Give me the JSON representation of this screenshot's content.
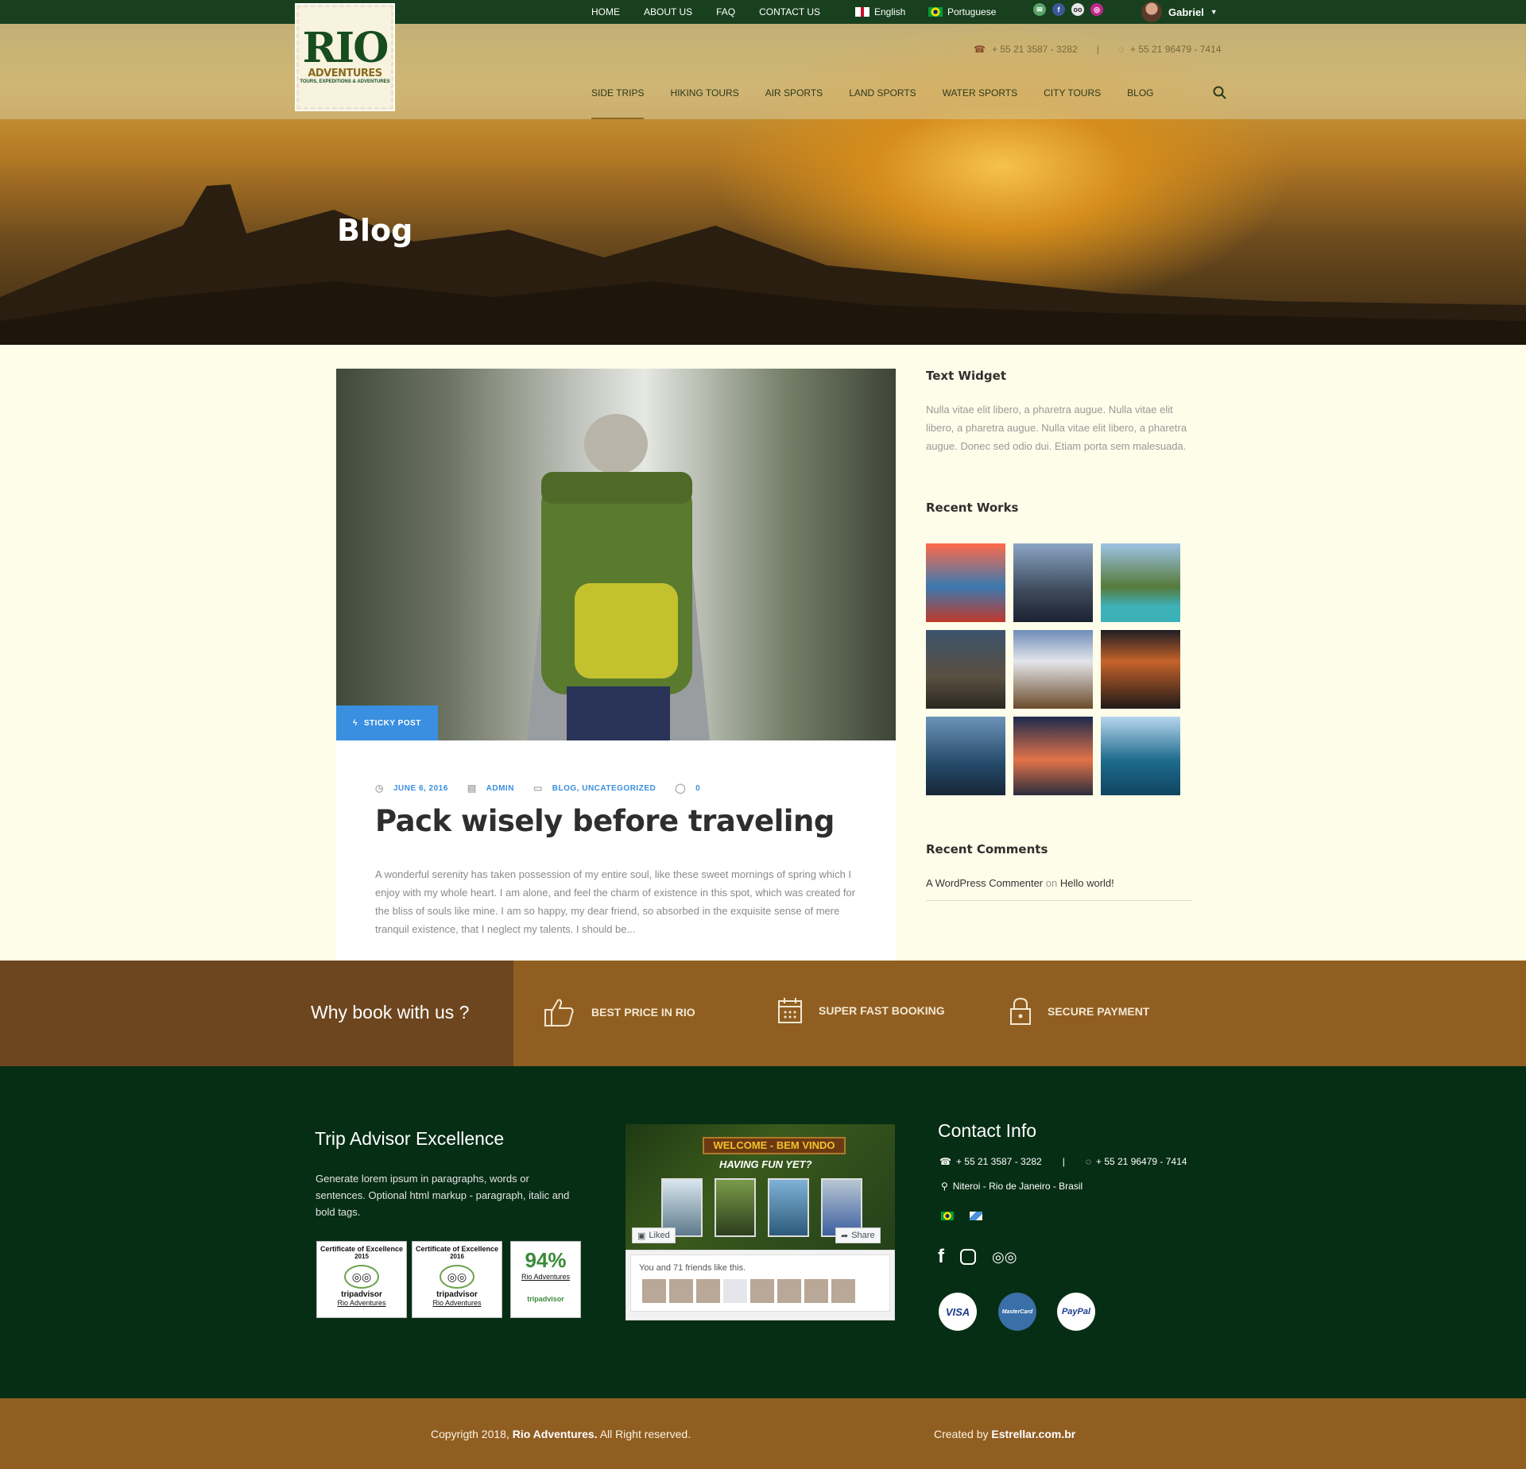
{
  "topbar": {
    "nav": [
      "HOME",
      "ABOUT US",
      "FAQ",
      "CONTACT US"
    ],
    "lang_en": "English",
    "lang_pt": "Portuguese",
    "user_name": "Gabriel"
  },
  "logo": {
    "line1": "RIO",
    "line2": "ADVENTURES",
    "line3": "TOURS, EXPEDITIONS & ADVENTURES"
  },
  "header": {
    "phone1": "+ 55 21 3587 - 3282",
    "phone2": "+ 55 21 96479 - 7414",
    "nav": [
      "SIDE TRIPS",
      "HIKING TOURS",
      "AIR SPORTS",
      "LAND SPORTS",
      "WATER SPORTS",
      "CITY TOURS",
      "BLOG"
    ]
  },
  "hero": {
    "title": "Blog"
  },
  "post": {
    "badge": "STICKY POST",
    "date": "JUNE 6, 2016",
    "author": "ADMIN",
    "categories": "BLOG, UNCATEGORIZED",
    "comments": "0",
    "title": "Pack wisely before traveling",
    "excerpt": "A wonderful serenity has taken possession of my entire soul, like these sweet mornings of spring which I enjoy with my whole heart. I am alone, and feel the charm of existence in this spot, which was created for the bliss of souls like mine. I am so happy, my dear friend, so absorbed in the exquisite sense of mere tranquil existence, that I neglect my talents. I should be..."
  },
  "sidebar": {
    "text_widget_title": "Text Widget",
    "text_widget_body": "Nulla vitae elit libero, a pharetra augue. Nulla vitae elit libero, a pharetra augue. Nulla vitae elit libero, a pharetra augue. Donec sed odio dui. Etiam porta sem malesuada.",
    "recent_works_title": "Recent Works",
    "recent_comments_title": "Recent Comments",
    "comment_author": "A WordPress Commenter",
    "comment_on": "on",
    "comment_post": "Hello world!"
  },
  "why": {
    "title": "Why book with us ?",
    "items": [
      "BEST PRICE IN RIO",
      "SUPER FAST BOOKING",
      "SECURE PAYMENT"
    ]
  },
  "footer": {
    "tripadvisor_title": "Trip Advisor Excellence",
    "tripadvisor_text": "Generate lorem ipsum in paragraphs, words or sentences. Optional html markup - paragraph, italic and bold tags.",
    "cert1_title": "Certificate of Excellence",
    "cert1_year": "2015",
    "cert2_title": "Certificate of Excellence",
    "cert2_year": "2016",
    "cert_brand": "tripadvisor",
    "cert_link": "Rio Adventures",
    "badge_pct": "94%",
    "fb_welcome": "WELCOME - BEM VINDO",
    "fb_having_fun": "HAVING FUN YET?",
    "fb_liked": "Liked",
    "fb_share": "Share",
    "fb_friends": "You and 71 friends like this.",
    "contact_title": "Contact Info",
    "contact_phone1": "+ 55 21 3587 - 3282",
    "contact_phone2": "+ 55 21 96479 - 7414",
    "contact_address": "Niteroi - Rio de Janeiro - Brasil",
    "pay_visa": "VISA",
    "pay_mc": "MasterCard",
    "pay_paypal": "PayPal"
  },
  "bottom": {
    "copyright": "Copyrigth 2018,",
    "brand": "Rio Adventures.",
    "rights": "All Right reserved.",
    "created_by": "Created by",
    "creator": "Estrellar.com.br"
  },
  "colors": {
    "dark_green": "#062e15",
    "brown": "#915e22",
    "dark_brown": "#6d461f",
    "accent_blue": "#3a8fe0",
    "page_bg": "#fefde9"
  }
}
